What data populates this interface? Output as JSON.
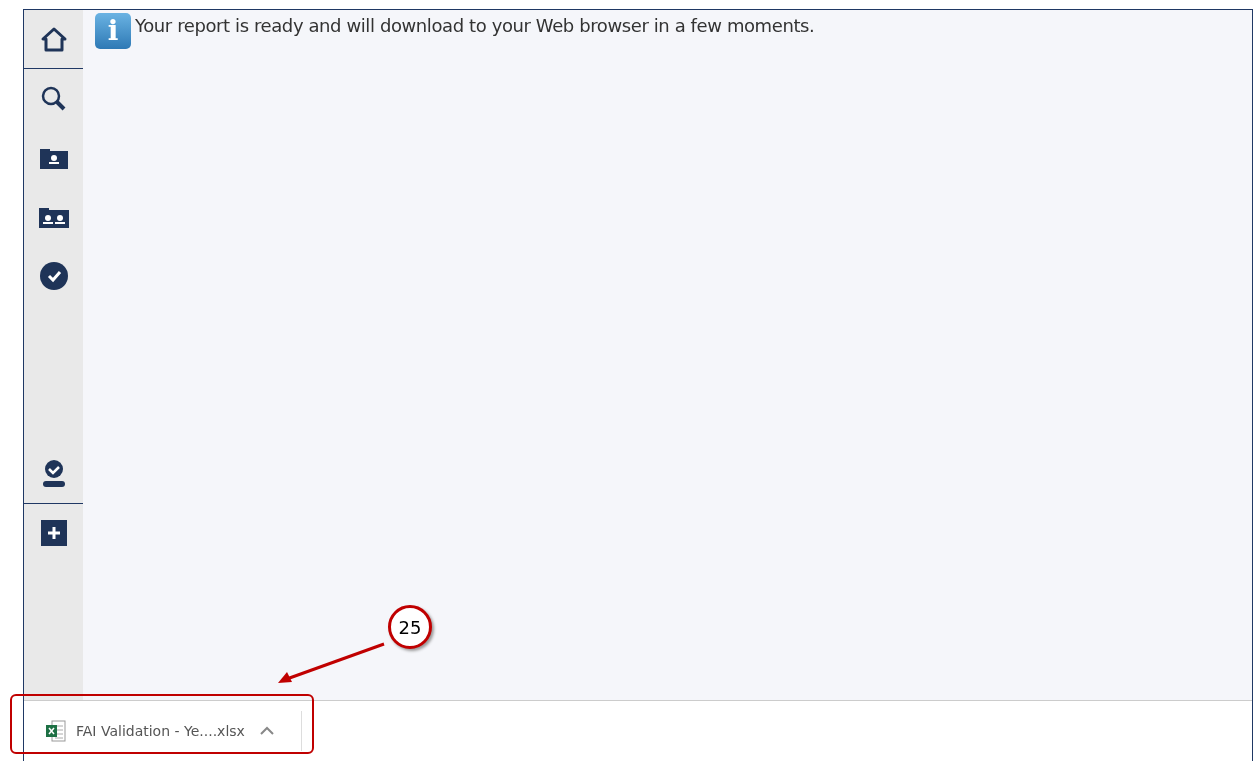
{
  "message": {
    "glyph": "i",
    "text": "Your report is ready and will download to your Web browser in a few moments."
  },
  "download_bar": {
    "file_name": "FAI Validation - Ye....xlsx"
  },
  "annotation": {
    "label": "25"
  }
}
